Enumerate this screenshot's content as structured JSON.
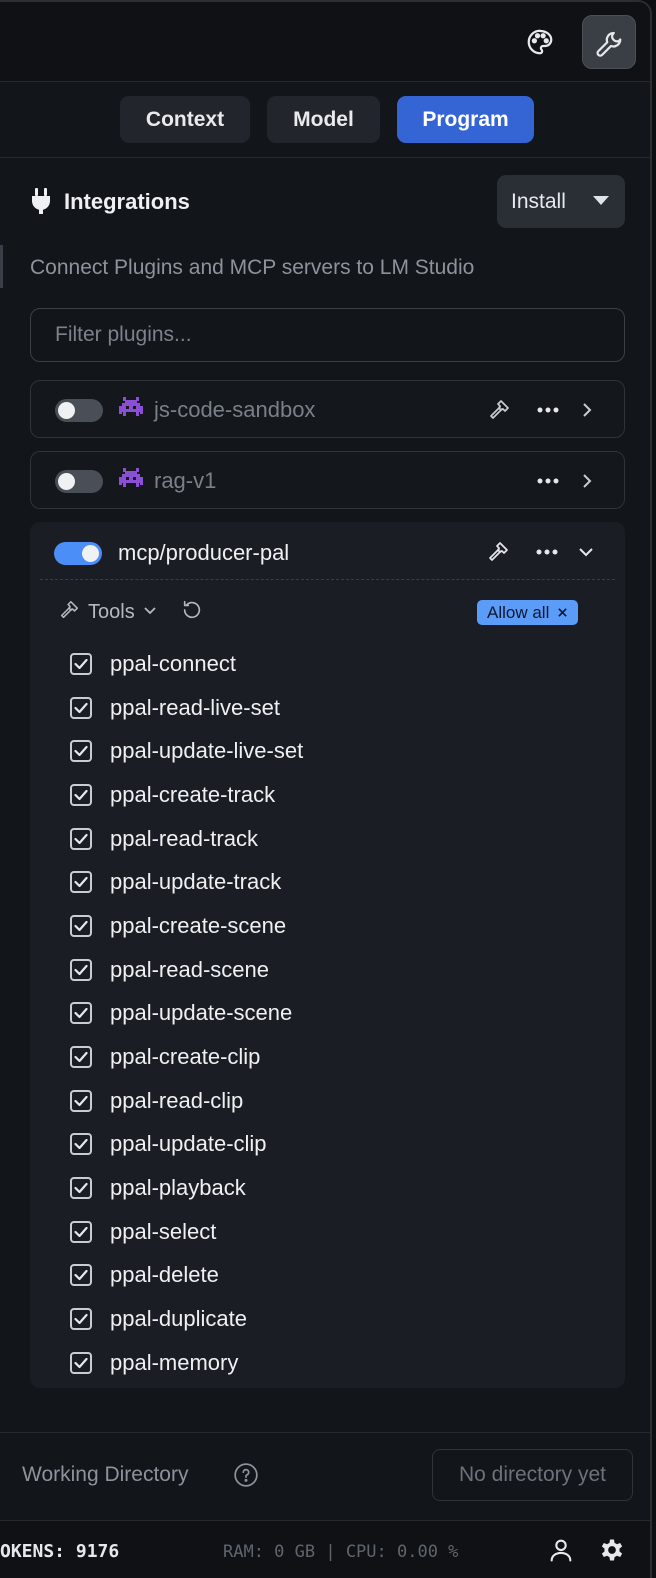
{
  "tabs": [
    {
      "label": "Context",
      "active": false
    },
    {
      "label": "Model",
      "active": false
    },
    {
      "label": "Program",
      "active": true
    }
  ],
  "integrations": {
    "title": "Integrations",
    "install_label": "Install",
    "subtitle": "Connect Plugins and MCP servers to LM Studio",
    "filter_placeholder": "Filter plugins..."
  },
  "plugins": [
    {
      "name": "js-code-sandbox",
      "enabled": false,
      "icon": "alien-icon"
    },
    {
      "name": "rag-v1",
      "enabled": false,
      "icon": "alien-icon"
    }
  ],
  "expanded_plugin": {
    "name": "mcp/producer-pal",
    "enabled": true,
    "tools_label": "Tools",
    "allow_all_label": "Allow all",
    "tools": [
      "ppal-connect",
      "ppal-read-live-set",
      "ppal-update-live-set",
      "ppal-create-track",
      "ppal-read-track",
      "ppal-update-track",
      "ppal-create-scene",
      "ppal-read-scene",
      "ppal-update-scene",
      "ppal-create-clip",
      "ppal-read-clip",
      "ppal-update-clip",
      "ppal-playback",
      "ppal-select",
      "ppal-delete",
      "ppal-duplicate",
      "ppal-memory"
    ]
  },
  "working_directory": {
    "label": "Working Directory",
    "value": "No directory yet"
  },
  "status": {
    "tokens": "OKENS: 9176",
    "system": "RAM: 0 GB | CPU: 0.00 %"
  },
  "colors": {
    "accent": "#3565d4",
    "toggle_on": "#5b9cf8",
    "plugin_icon": "#8b4fd6",
    "background": "#121519"
  }
}
